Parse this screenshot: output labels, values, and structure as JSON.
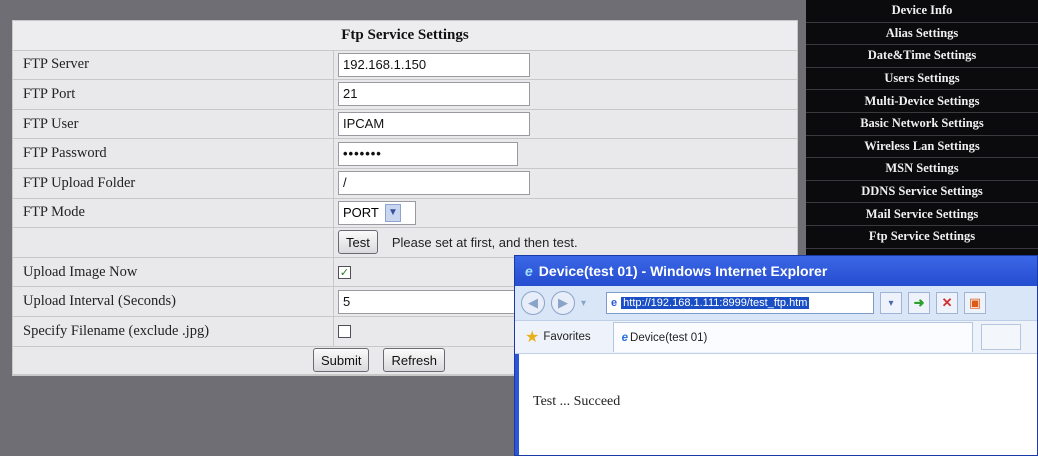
{
  "settings": {
    "title": "Ftp Service Settings",
    "rows": {
      "server": {
        "label": "FTP Server",
        "value": "192.168.1.150"
      },
      "port": {
        "label": "FTP Port",
        "value": "21"
      },
      "user": {
        "label": "FTP User",
        "value": "IPCAM"
      },
      "password": {
        "label": "FTP Password",
        "value": "•••••••"
      },
      "folder": {
        "label": "FTP Upload Folder",
        "value": "/"
      },
      "mode": {
        "label": "FTP Mode",
        "value": "PORT"
      },
      "test": {
        "button": "Test",
        "note": "Please set at first, and then test."
      },
      "upload_now": {
        "label": "Upload Image Now",
        "checked": true
      },
      "interval": {
        "label": "Upload Interval (Seconds)",
        "value": "5"
      },
      "filename": {
        "label": "Specify Filename (exclude .jpg)",
        "checked": false
      }
    },
    "submit": "Submit",
    "refresh": "Refresh"
  },
  "menu": [
    "Device Info",
    "Alias Settings",
    "Date&Time Settings",
    "Users Settings",
    "Multi-Device Settings",
    "Basic Network Settings",
    "Wireless Lan Settings",
    "MSN Settings",
    "DDNS Service Settings",
    "Mail Service Settings",
    "Ftp Service Settings"
  ],
  "ie": {
    "title": "Device(test 01) - Windows Internet Explorer",
    "url": "http://192.168.1.111:8999/test_ftp.htm",
    "favorites": "Favorites",
    "tab_title": "Device(test 01)",
    "body_text": "Test ... Succeed"
  }
}
